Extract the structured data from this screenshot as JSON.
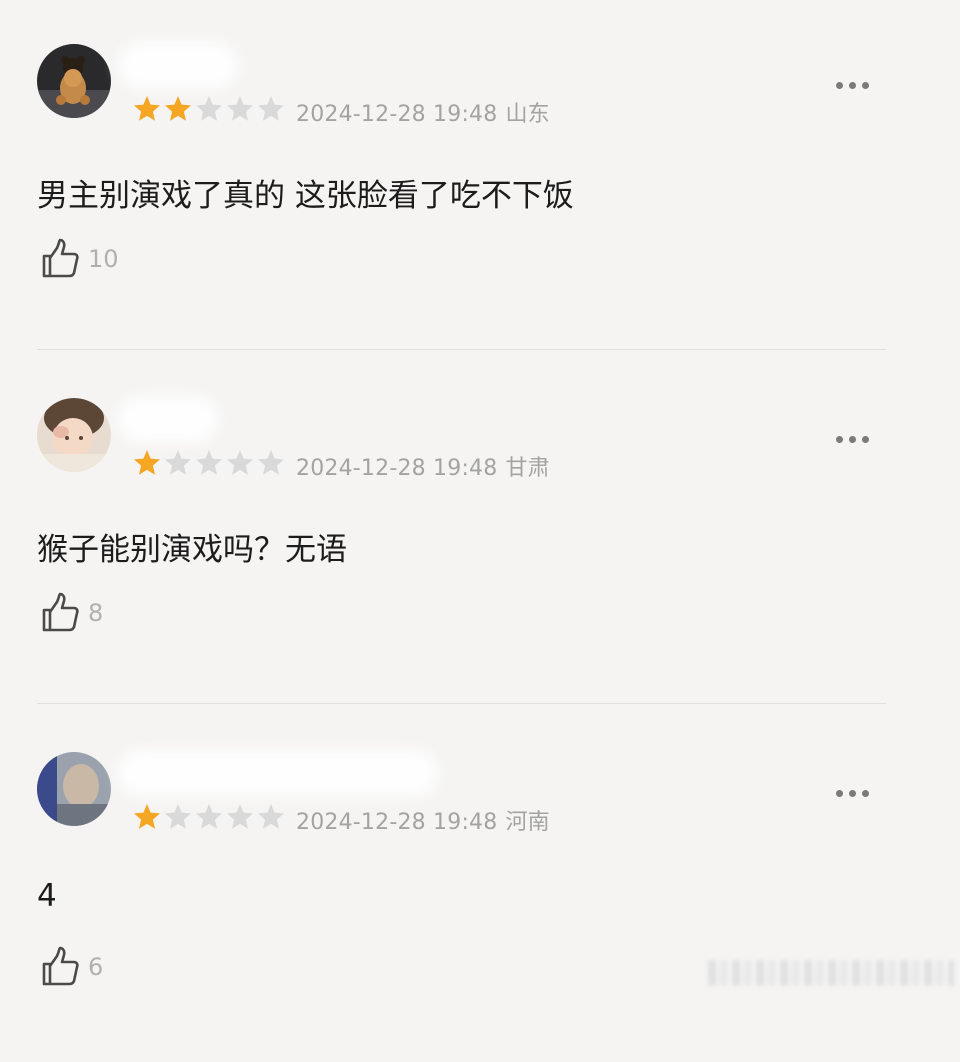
{
  "reviews": [
    {
      "avatar": "avatar-teddy-bear",
      "rating": 2,
      "max_rating": 5,
      "datetime": "2024-12-28 19:48",
      "location": "山东",
      "content": "男主别演戏了真的 这张脸看了吃不下饭",
      "likes": "10"
    },
    {
      "avatar": "avatar-child-photo",
      "rating": 1,
      "max_rating": 5,
      "datetime": "2024-12-28 19:48",
      "location": "甘肃",
      "content": "猴子能别演戏吗？无语",
      "likes": "8"
    },
    {
      "avatar": "avatar-blurred-photo",
      "rating": 1,
      "max_rating": 5,
      "datetime": "2024-12-28 19:48",
      "location": "河南",
      "content": "4",
      "likes": "6"
    }
  ],
  "icons": {
    "more": "more-dots-icon",
    "like": "thumbs-up-icon",
    "star": "star-icon"
  },
  "colors": {
    "star_filled": "#f5a623",
    "star_empty": "#d9d9d9",
    "meta_text": "#a3a3a3",
    "background": "#f5f4f3"
  }
}
